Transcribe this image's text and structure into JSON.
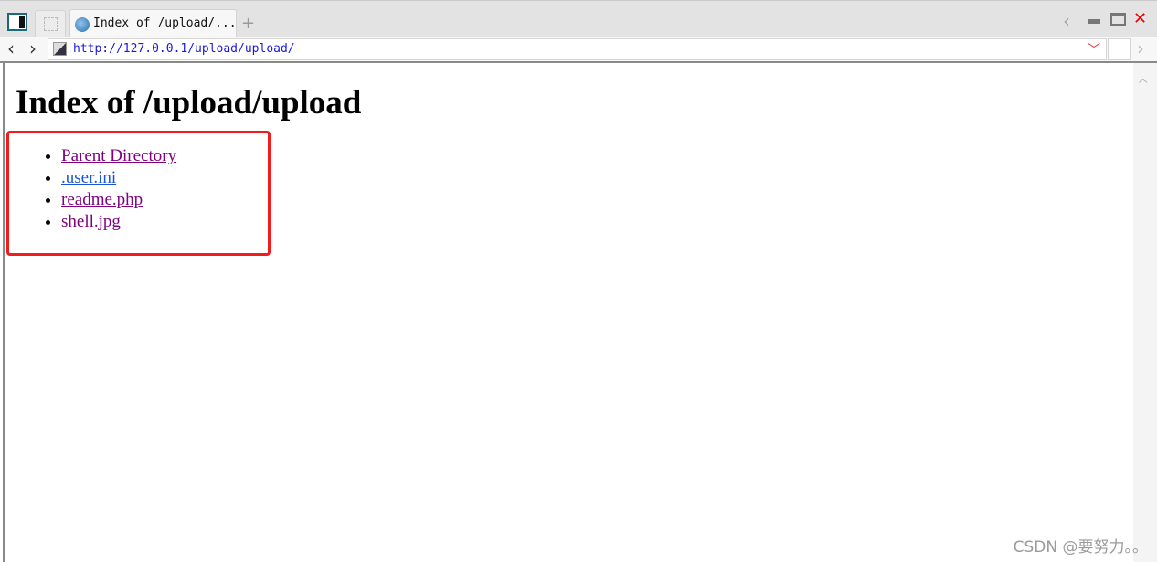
{
  "browser": {
    "tab_title": "Index of /upload/...",
    "url": "http://127.0.0.1/upload/upload/"
  },
  "page": {
    "heading": "Index of /upload/upload",
    "links": [
      {
        "label": "Parent Directory"
      },
      {
        "label": ".user.ini"
      },
      {
        "label": "readme.php"
      },
      {
        "label": "shell.jpg"
      }
    ]
  },
  "annotation": {
    "highlight_color": "#f21c1c"
  },
  "watermark": "CSDN @要努力。。"
}
